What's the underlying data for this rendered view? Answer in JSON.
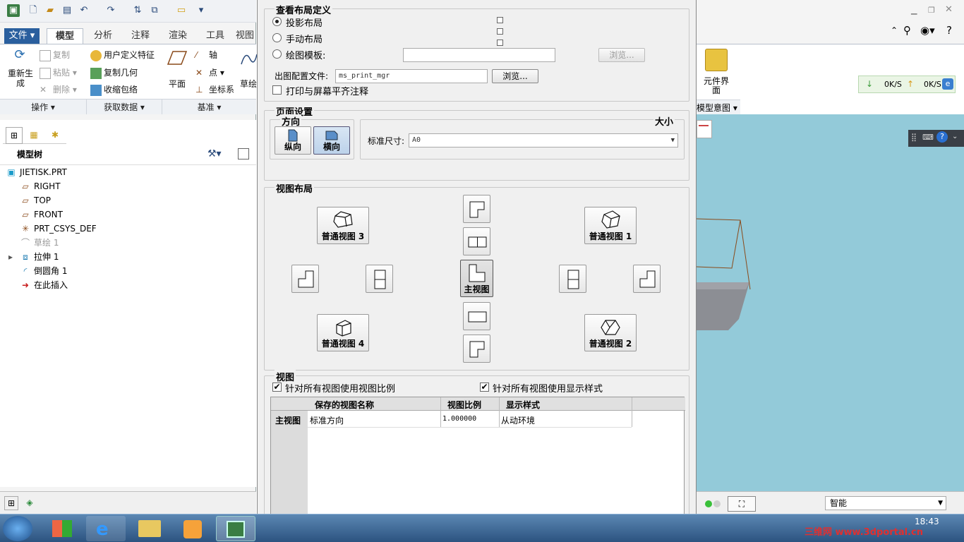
{
  "qat": {
    "icons": [
      "app-icon",
      "new-icon",
      "open-icon",
      "save-icon",
      "undo-icon",
      "redo-icon",
      "regenerate-icon",
      "windows-icon",
      "close-window-icon",
      "customize-icon"
    ]
  },
  "tabs": [
    "文件",
    "模型",
    "分析",
    "注释",
    "渲染",
    "工具",
    "视图"
  ],
  "ribbon": {
    "regen": "重新生成",
    "copy": "复制",
    "paste": "粘贴",
    "delete": "删除",
    "udf": "用户定义特征",
    "copy_geom": "复制几何",
    "shrinkwrap": "收缩包络",
    "plane": "平面",
    "axis": "轴",
    "point": "点",
    "csys": "坐标系",
    "sketch": "草绘",
    "groups": [
      "操作",
      "获取数据",
      "基准"
    ]
  },
  "model_tree": {
    "title": "模型树",
    "items": [
      {
        "label": "JIETISK.PRT",
        "icon": "part-icon"
      },
      {
        "label": "RIGHT",
        "icon": "datum-plane-icon"
      },
      {
        "label": "TOP",
        "icon": "datum-plane-icon"
      },
      {
        "label": "FRONT",
        "icon": "datum-plane-icon"
      },
      {
        "label": "PRT_CSYS_DEF",
        "icon": "csys-icon"
      },
      {
        "label": "草绘 1",
        "icon": "sketch-icon"
      },
      {
        "label": "拉伸 1",
        "icon": "extrude-icon"
      },
      {
        "label": "倒圆角 1",
        "icon": "round-icon"
      },
      {
        "label": "在此插入",
        "icon": "insert-here-icon"
      }
    ]
  },
  "dialog": {
    "layout_def": {
      "legend": "查看布局定义",
      "projection": "投影布局",
      "manual": "手动布局",
      "template": "绘图模板:",
      "browse1": "浏览...",
      "config_label": "出图配置文件:",
      "config_value": "ms_print_mgr",
      "browse2": "浏览...",
      "align_notes": "打印与屏幕平齐注释"
    },
    "page": {
      "legend": "页面设置",
      "orient_legend": "方向",
      "portrait": "纵向",
      "landscape": "横向",
      "size_legend": "大小",
      "std_size": "标准尺寸:",
      "size_value": "A0"
    },
    "view_layout": {
      "legend": "视图布局",
      "general3": "普通视图 3",
      "general1": "普通视图 1",
      "general4": "普通视图 4",
      "general2": "普通视图 2",
      "main": "主视图"
    },
    "views": {
      "legend": "视图",
      "cb_scale": "针对所有视图使用视图比例",
      "cb_style": "针对所有视图使用显示样式",
      "columns": [
        "保存的视图名称",
        "视图比例",
        "显示样式"
      ],
      "row_header": "主视图",
      "row": [
        "标准方向",
        "1.000000",
        "从动环境"
      ]
    }
  },
  "right": {
    "component_ui": "元件界面",
    "model_intent": "模型意图",
    "down_speed": "0K/S",
    "up_speed": "0K/S",
    "status_select": "智能"
  },
  "taskbar": {
    "clock": "18:43",
    "watermark": "三维网 www.3dportal.cn"
  },
  "colors": {
    "viewport": "#93cad9",
    "accent": "#2a5f9e"
  }
}
